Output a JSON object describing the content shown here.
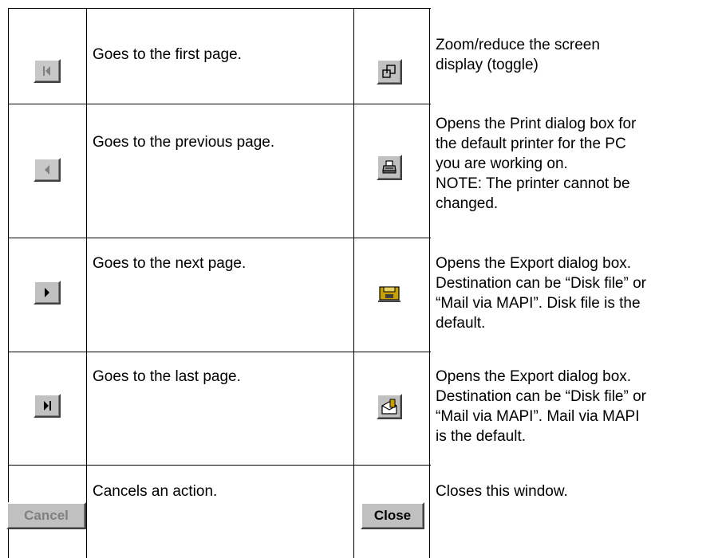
{
  "rows": [
    {
      "left": {
        "icon": "first-page-icon",
        "text": "Goes to the first page."
      },
      "right": {
        "icon": "zoom-toggle-icon",
        "lines": [
          "Zoom/reduce the screen",
          "display (toggle)"
        ]
      }
    },
    {
      "left": {
        "icon": "previous-page-icon",
        "text": "Goes to the previous page."
      },
      "right": {
        "icon": "printer-icon",
        "lines": [
          "Opens the Print dialog box for",
          "the default printer for the PC",
          "you are working on.",
          "NOTE: The printer cannot be",
          "changed."
        ]
      }
    },
    {
      "left": {
        "icon": "next-page-icon",
        "text": "Goes to the next page."
      },
      "right": {
        "icon": "export-disk-icon",
        "lines": [
          "Opens the Export dialog box.",
          "Destination can be “Disk file” or",
          "“Mail via MAPI”. Disk file is the",
          "default."
        ]
      }
    },
    {
      "left": {
        "icon": "last-page-icon",
        "text": "Goes to the last page."
      },
      "right": {
        "icon": "export-mail-icon",
        "lines": [
          "Opens the Export dialog box.",
          "Destination can be “Disk file” or",
          "“Mail via MAPI”. Mail via MAPI",
          "is the default."
        ]
      }
    },
    {
      "left": {
        "button": "Cancel",
        "text": "Cancels an action."
      },
      "right": {
        "button": "Close",
        "lines": [
          "Closes this window."
        ]
      }
    }
  ],
  "colors": {
    "button_face": "#c0c0c0",
    "disabled_text": "#808080",
    "disk_icon": "#c8a000"
  }
}
